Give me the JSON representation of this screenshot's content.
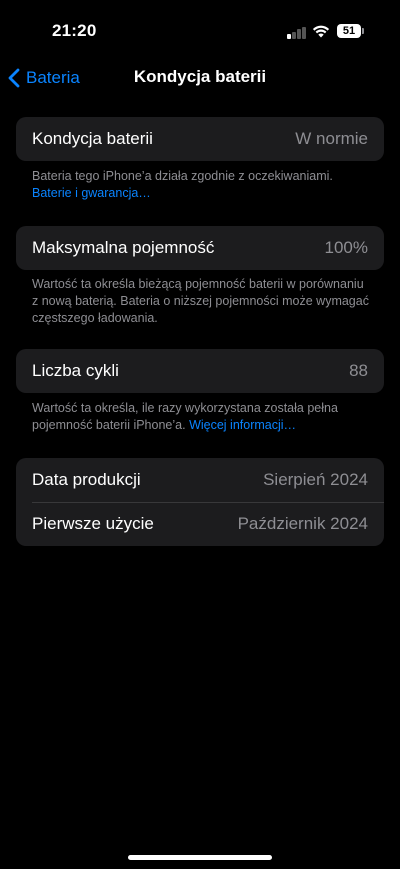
{
  "status_bar": {
    "time": "21:20",
    "battery_percent": "51",
    "signal_bars_active": 1,
    "signal_bars_total": 4,
    "wifi_icon": "wifi-icon"
  },
  "nav": {
    "back_label": "Bateria",
    "title": "Kondycja baterii"
  },
  "health": {
    "label": "Kondycja baterii",
    "value": "W normie",
    "note": "Bateria tego iPhone’a działa zgodnie z oczekiwaniami.",
    "link": "Baterie i gwarancja…"
  },
  "capacity": {
    "label": "Maksymalna pojemność",
    "value": "100%",
    "note": "Wartość ta określa bieżącą pojemność baterii w porównaniu z nową baterią. Bateria o niższej pojemności może wymagać częstszego ładowania."
  },
  "cycles": {
    "label": "Liczba cykli",
    "value": "88",
    "note": "Wartość ta określa, ile razy wykorzystana została pełna pojemność baterii iPhone’a.",
    "link": "Więcej informacji…"
  },
  "dates": {
    "manufacture_label": "Data produkcji",
    "manufacture_value": "Sierpień 2024",
    "first_use_label": "Pierwsze użycie",
    "first_use_value": "Październik 2024"
  },
  "colors": {
    "background": "#000000",
    "cell": "#1c1c1e",
    "accent": "#0a84ff",
    "secondary_text": "#8e8e93"
  }
}
